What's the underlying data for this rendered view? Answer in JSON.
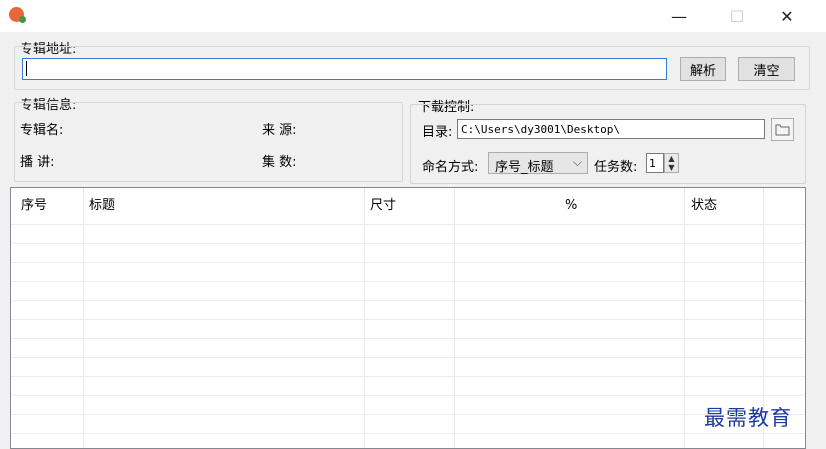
{
  "window": {
    "minimize_glyph": "—",
    "maximize_glyph": "☐",
    "close_glyph": "✕"
  },
  "album_address": {
    "label": "专辑地址:",
    "value": "",
    "parse_button": "解析",
    "clear_button": "清空"
  },
  "album_info": {
    "group_label": "专辑信息:",
    "name_label": "专辑名:",
    "source_label": "来  源:",
    "narrator_label": "播  讲:",
    "episodes_label": "集  数:"
  },
  "download_control": {
    "group_label": "下载控制:",
    "directory_label": "目录:",
    "directory_value": "C:\\Users\\dy3001\\Desktop\\",
    "naming_label": "命名方式:",
    "naming_value": "序号_标题",
    "task_count_label": "任务数:",
    "task_count_value": "1"
  },
  "table": {
    "columns": [
      "序号",
      "标题",
      "尺寸",
      "%",
      "状态"
    ]
  },
  "watermark": "最需教育"
}
